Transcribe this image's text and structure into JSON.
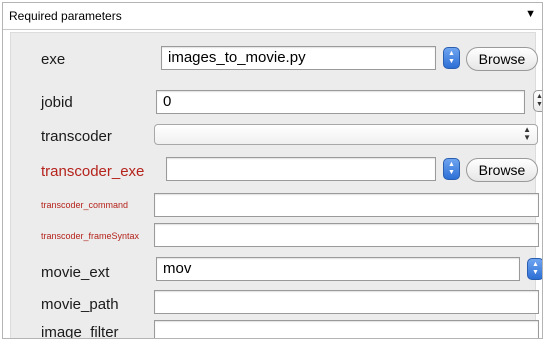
{
  "header": {
    "title": "Required parameters",
    "toggle_icon": "triangle-down-icon"
  },
  "rows": {
    "exe": {
      "label": "exe",
      "value": "images_to_movie.py",
      "browse": "Browse"
    },
    "jobid": {
      "label": "jobid",
      "value": "0"
    },
    "transcoder": {
      "label": "transcoder",
      "value": ""
    },
    "transcoder_exe": {
      "label": "transcoder_exe",
      "value": "",
      "browse": "Browse"
    },
    "transcoder_command": {
      "label": "transcoder_command",
      "value": ""
    },
    "transcoder_frameSyntax": {
      "label": "transcoder_frameSyntax",
      "value": ""
    },
    "movie_ext": {
      "label": "movie_ext",
      "value": "mov"
    },
    "movie_path": {
      "label": "movie_path",
      "value": ""
    },
    "image_filter": {
      "label": "image_filter",
      "value": ""
    }
  },
  "colors": {
    "required_label": "#b5231c",
    "stepper_blue": "#2d6fd6"
  }
}
